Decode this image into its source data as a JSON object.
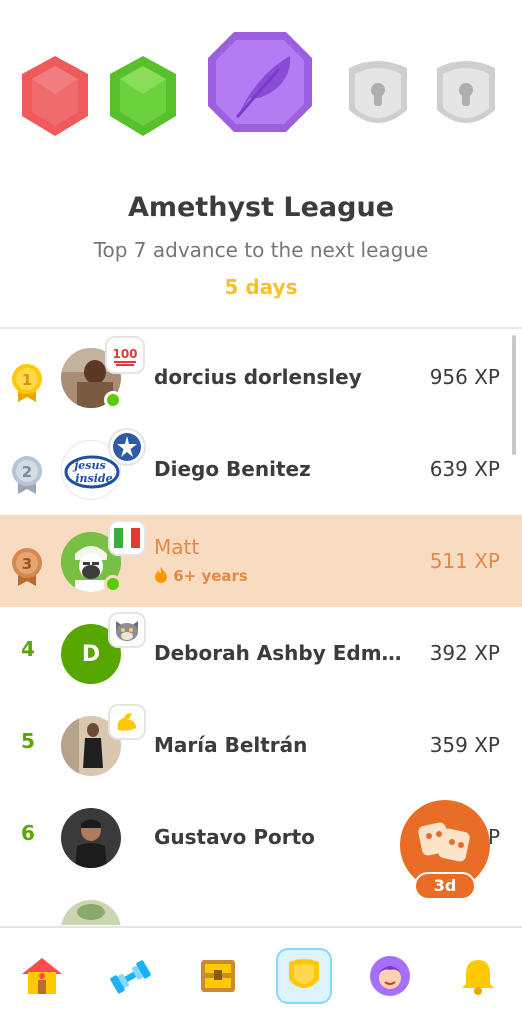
{
  "league": {
    "title": "Amethyst League",
    "subtitle": "Top 7 advance to the next league",
    "time_left": "5 days"
  },
  "badges": [
    {
      "name": "ruby",
      "color": "#ef5b5b",
      "state": "unlocked"
    },
    {
      "name": "emerald",
      "color": "#6bd13c",
      "state": "unlocked"
    },
    {
      "name": "amethyst",
      "color": "#b37cf2",
      "state": "current"
    },
    {
      "name": "locked-1",
      "color": "#d7d7d7",
      "state": "locked"
    },
    {
      "name": "locked-2",
      "color": "#d7d7d7",
      "state": "locked"
    }
  ],
  "leaderboard": [
    {
      "rank": "1",
      "name": "dorcius dorlensley",
      "xp": "956 XP",
      "flair": "100",
      "online": true
    },
    {
      "rank": "2",
      "name": "Diego Benitez",
      "xp": "639 XP",
      "flair": "star",
      "online": false
    },
    {
      "rank": "3",
      "name": "Matt",
      "xp": "511 XP",
      "streak": "6+ years",
      "flair": "italy-flag",
      "online": true,
      "current_user": true
    },
    {
      "rank": "4",
      "name": "Deborah Ashby Edm...",
      "xp": "392 XP",
      "avatar_letter": "D",
      "flair": "cat"
    },
    {
      "rank": "5",
      "name": "María Beltrán",
      "xp": "359 XP",
      "flair": "duo-arm"
    },
    {
      "rank": "6",
      "name": "Gustavo Porto",
      "xp": "P",
      "flair": ""
    }
  ],
  "chest": {
    "label": "3d"
  },
  "nav": [
    {
      "name": "home-icon",
      "active": false
    },
    {
      "name": "dumbbell-icon",
      "active": false
    },
    {
      "name": "treasure-icon",
      "active": false
    },
    {
      "name": "shield-icon",
      "active": true
    },
    {
      "name": "profile-icon",
      "active": false
    },
    {
      "name": "bell-icon",
      "active": false
    }
  ],
  "colors": {
    "accent_gold": "#f7c12e",
    "highlight_row": "#f8dcc1",
    "rank_green": "#58a700",
    "orange": "#e96d26"
  }
}
